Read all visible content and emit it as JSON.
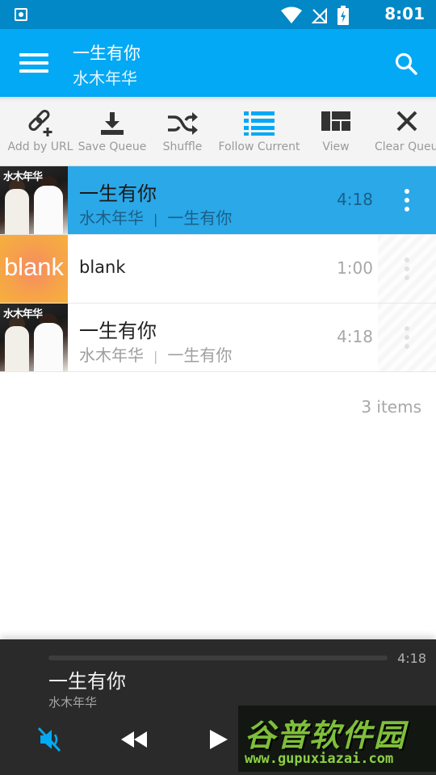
{
  "status_bar": {
    "time": "8:01"
  },
  "app_bar": {
    "title": "一生有你",
    "subtitle": "水木年华"
  },
  "toolbar": {
    "items": [
      {
        "label": "Add by URL",
        "icon": "link-add-icon"
      },
      {
        "label": "Save Queue",
        "icon": "download-icon"
      },
      {
        "label": "Shuffle",
        "icon": "shuffle-icon"
      },
      {
        "label": "Follow Current",
        "icon": "list-icon"
      },
      {
        "label": "View",
        "icon": "view-grid-icon"
      },
      {
        "label": "Clear Queue",
        "icon": "close-icon"
      }
    ],
    "accent_active": "#03a9f4"
  },
  "queue": {
    "rows": [
      {
        "title": "一生有你",
        "artist": "水木年华",
        "album": "一生有你",
        "duration": "4:18",
        "active": true
      },
      {
        "title": "blank",
        "thumb_text": "blank",
        "duration": "1:00",
        "active": false
      },
      {
        "title": "一生有你",
        "artist": "水木年华",
        "album": "一生有你",
        "duration": "4:18",
        "active": false
      }
    ],
    "album_art_text": "水木年华",
    "separator": "|",
    "count_text": "3 items"
  },
  "player": {
    "title": "一生有你",
    "artist": "水木年华",
    "duration": "4:18",
    "progress": 0.0,
    "muted": true
  },
  "watermark": {
    "brand": "谷普软件园",
    "url": "www.gupuxiazai.com"
  },
  "colors": {
    "status_bar": "#0288c7",
    "app_bar": "#03a9f4",
    "active_row": "#2aa8e8",
    "player_bg": "#2a2a2a"
  }
}
